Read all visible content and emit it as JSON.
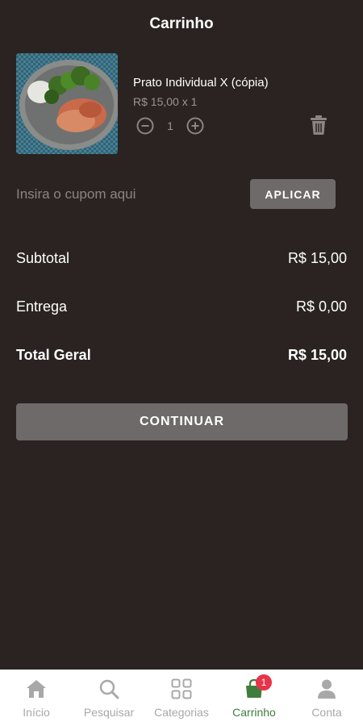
{
  "header": {
    "title": "Carrinho"
  },
  "cart": {
    "items": [
      {
        "name": "Prato Individual X (cópia)",
        "price_line": "R$ 15,00 x 1",
        "quantity": "1"
      }
    ]
  },
  "coupon": {
    "placeholder": "Insira o cupom aqui",
    "apply_label": "APLICAR"
  },
  "summary": {
    "subtotal_label": "Subtotal",
    "subtotal_value": "R$ 15,00",
    "delivery_label": "Entrega",
    "delivery_value": "R$ 0,00",
    "total_label": "Total Geral",
    "total_value": "R$ 15,00"
  },
  "continue_label": "CONTINUAR",
  "nav": {
    "items": [
      {
        "label": "Início",
        "icon": "home-icon"
      },
      {
        "label": "Pesquisar",
        "icon": "search-icon"
      },
      {
        "label": "Categorias",
        "icon": "grid-icon"
      },
      {
        "label": "Carrinho",
        "icon": "shopping-bag-icon",
        "badge": "1",
        "active": true
      },
      {
        "label": "Conta",
        "icon": "user-icon"
      }
    ]
  },
  "colors": {
    "background": "#2a2321",
    "button": "#6d6a69",
    "active_nav": "#3f7d3c",
    "badge": "#e8334a",
    "inactive_nav": "#a8a8a8"
  }
}
